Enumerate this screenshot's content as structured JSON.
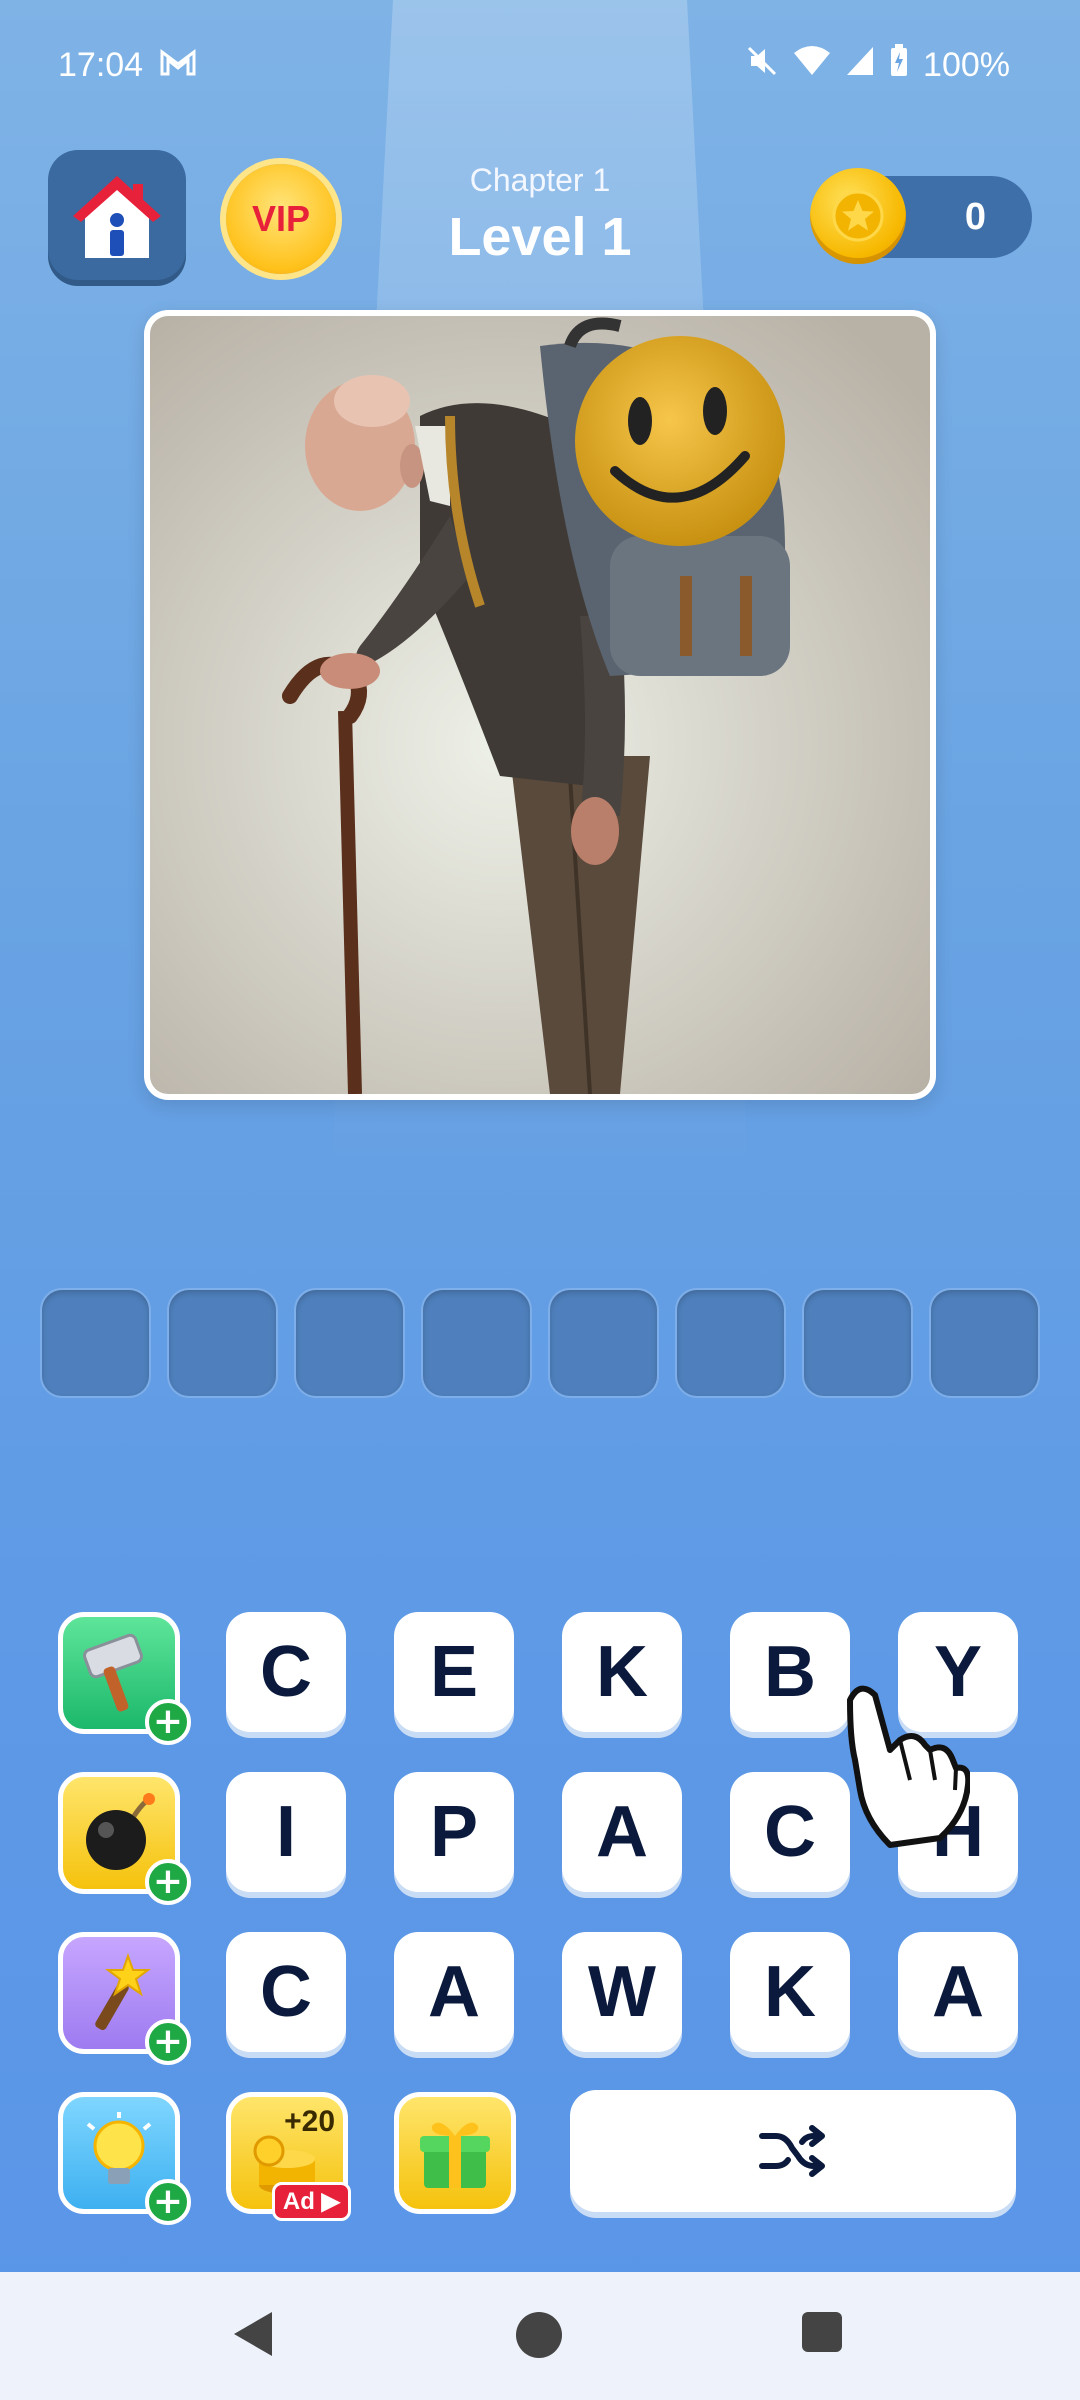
{
  "status_bar": {
    "time": "17:04",
    "battery": "100%",
    "icons": [
      "gmail-icon",
      "mute-icon",
      "wifi-icon",
      "signal-icon",
      "battery-charging-icon"
    ]
  },
  "header": {
    "chapter": "Chapter 1",
    "level": "Level 1",
    "vip_label": "VIP",
    "coins": "0"
  },
  "puzzle": {
    "image_alt": "old-man-with-smiley-backpack-and-cane",
    "answer_length": 8
  },
  "boosters": {
    "hammer": "hammer-icon",
    "bomb": "bomb-icon",
    "wand": "magic-wand-icon",
    "hint": "light-bulb-icon",
    "coins_ad_label": "+20",
    "ad_label": "Ad",
    "gift": "gift-icon"
  },
  "letters": [
    [
      "C",
      "E",
      "K",
      "B",
      "Y"
    ],
    [
      "I",
      "P",
      "A",
      "C",
      "H"
    ],
    [
      "C",
      "A",
      "W",
      "K",
      "A"
    ]
  ],
  "controls": {
    "shuffle": "shuffle-icon"
  },
  "colors": {
    "background": "#6aa4e3",
    "tile_text": "#0b1a3c",
    "slot": "#4f80bd",
    "plus_badge": "#1fa945",
    "vip": "#e8213b"
  }
}
